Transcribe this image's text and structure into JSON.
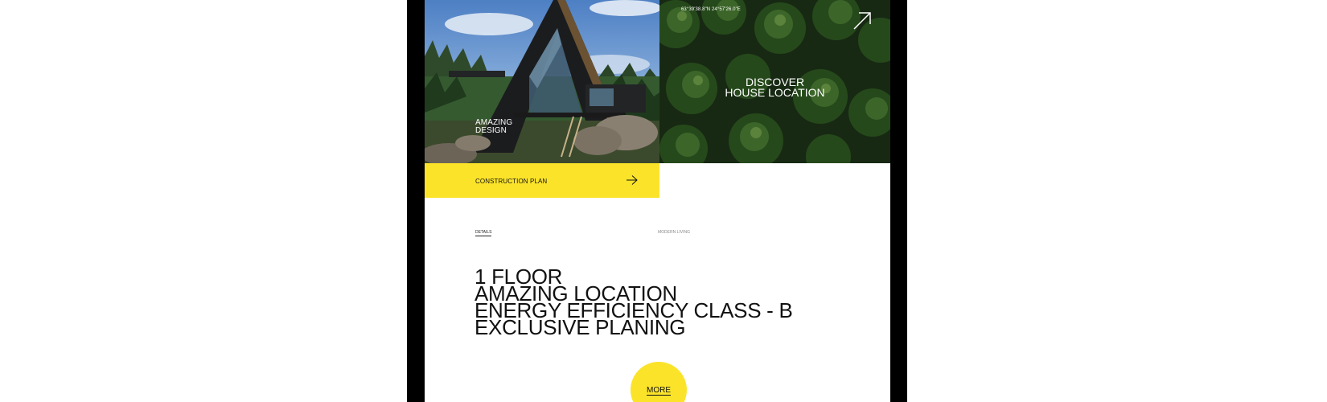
{
  "house_tile": {
    "caption_line1": "AMAZING",
    "caption_line2": "DESIGN"
  },
  "location_tile": {
    "coordinates": "63°39'38.8\"N 24°57'26.0\"E",
    "title_line1": "DISCOVER",
    "title_line2": "HOUSE LOCATION",
    "icon": "arrow-up-right-icon"
  },
  "plan_bar": {
    "label": "CONSTRUCTION PLAN",
    "icon": "arrow-right-icon"
  },
  "meta": {
    "details": "DETAILS",
    "category": "MODERN LIVING"
  },
  "features": [
    "1 FLOOR",
    "AMAZING LOCATION",
    "ENERGY EFFICIENCY CLASS - B",
    "EXCLUSIVE PLANING"
  ],
  "more_button": {
    "label": "MORE"
  },
  "colors": {
    "accent_yellow": "#fbe32a",
    "device_frame": "#000000",
    "text_dark": "#111111"
  }
}
